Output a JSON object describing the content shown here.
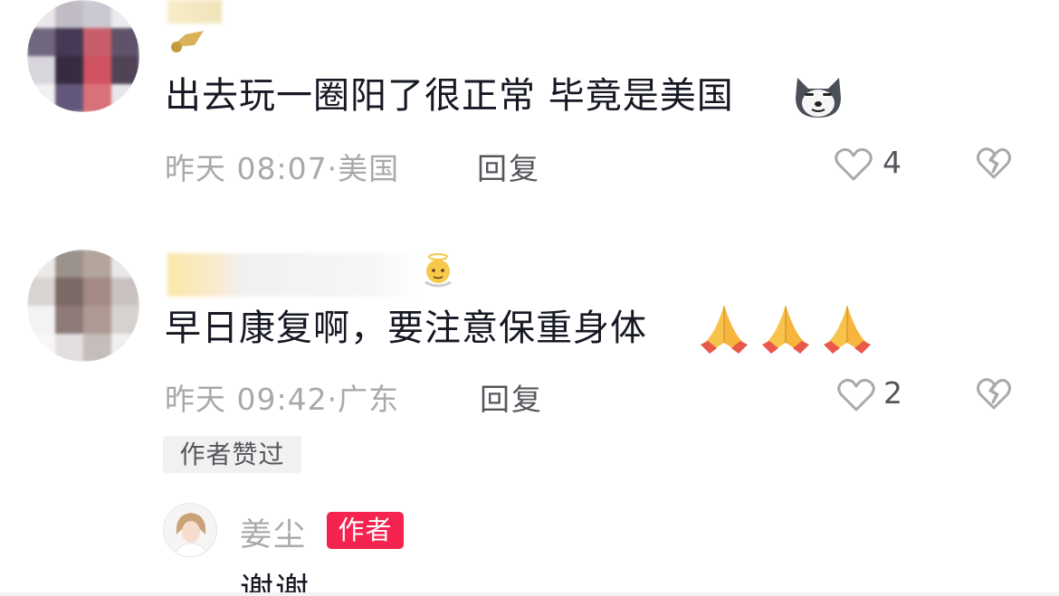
{
  "comments": [
    {
      "text": "出去玩一圈阳了很正常 毕竟是美国",
      "time": "昨天 08:07",
      "location": "美国",
      "reply_label": "回复",
      "likes": "4",
      "emoji": "husky-doge-emoji"
    },
    {
      "text": "早日康复啊，要注意保重身体",
      "time": "昨天 09:42",
      "location": "广东",
      "reply_label": "回复",
      "likes": "2",
      "emoji": "folded-hands-emoji",
      "liked_by_author": "作者赞过"
    }
  ],
  "author_reply": {
    "name": "姜尘",
    "badge": "作者",
    "text": "谢谢"
  },
  "separator": "·",
  "colors": {
    "author_badge": "#f4234f",
    "meta_gray": "#a8a9ad",
    "text_dark": "#161823"
  }
}
